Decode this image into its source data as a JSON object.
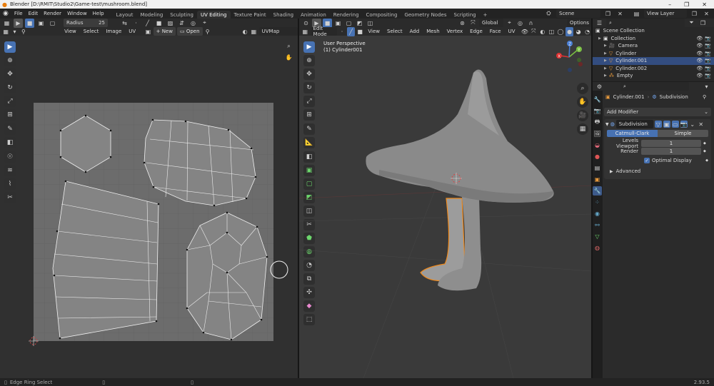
{
  "titlebar": {
    "title": "Blender [D:\\RMIT\\Studio2\\Game-test\\mushroom.blend]",
    "win_controls": [
      "–",
      "❐",
      "✕"
    ]
  },
  "topbar": {
    "menus": [
      "File",
      "Edit",
      "Render",
      "Window",
      "Help"
    ],
    "workspaces": [
      "Layout",
      "Modeling",
      "Sculpting",
      "UV Editing",
      "Texture Paint",
      "Shading",
      "Animation",
      "Rendering",
      "Compositing",
      "Geometry Nodes",
      "Scripting"
    ],
    "active_workspace": "UV Editing",
    "add_tab": "+",
    "scene": "Scene",
    "view_layer": "View Layer"
  },
  "uv_editor": {
    "tool_header": {
      "brush_label": "Radius",
      "brush_value": "25"
    },
    "menus": [
      "View",
      "Select",
      "Image",
      "UV"
    ],
    "new_label": "New",
    "open_label": "Open",
    "uvmap": "UVMap"
  },
  "viewport": {
    "mode": "Edit Mode",
    "menus": [
      "View",
      "Select",
      "Add",
      "Mesh",
      "Vertex",
      "Edge",
      "Face",
      "UV"
    ],
    "orientation": "Global",
    "options": "Options",
    "overlay_line1": "User Perspective",
    "overlay_line2": "(1) Cylinder001",
    "gizmo": {
      "x": "X",
      "y": "Y",
      "z": "Z"
    }
  },
  "outliner": {
    "root": "Scene Collection",
    "items": [
      {
        "name": "Collection",
        "level": 1,
        "icon": "collection-icon",
        "color": "#e0e0e0"
      },
      {
        "name": "Camera",
        "level": 2,
        "icon": "camera-icon",
        "color": "#e89a3c"
      },
      {
        "name": "Cylinder",
        "level": 2,
        "icon": "mesh-icon",
        "color": "#e89a3c"
      },
      {
        "name": "Cylinder.001",
        "level": 2,
        "icon": "mesh-icon",
        "color": "#e89a3c",
        "selected": true
      },
      {
        "name": "Cylinder.002",
        "level": 2,
        "icon": "mesh-icon",
        "color": "#e89a3c"
      },
      {
        "name": "Empty",
        "level": 2,
        "icon": "empty-icon",
        "color": "#e89a3c"
      }
    ]
  },
  "properties": {
    "object": "Cylinder.001",
    "modifier_breadcrumb": "Subdivision",
    "add_modifier": "Add Modifier",
    "modifier": {
      "name": "Subdivision",
      "type_options": [
        "Catmull-Clark",
        "Simple"
      ],
      "active_type": "Catmull-Clark",
      "levels_viewport_label": "Levels Viewport",
      "levels_viewport": "1",
      "render_label": "Render",
      "render": "1",
      "optimal_display": "Optimal Display",
      "advanced": "Advanced"
    }
  },
  "statusbar": {
    "left": "Edge Ring Select",
    "version": "2.93.5"
  },
  "colors": {
    "accent": "#4772b3",
    "selected_orange": "#f08a1c",
    "bg": "#1d1d1d"
  }
}
